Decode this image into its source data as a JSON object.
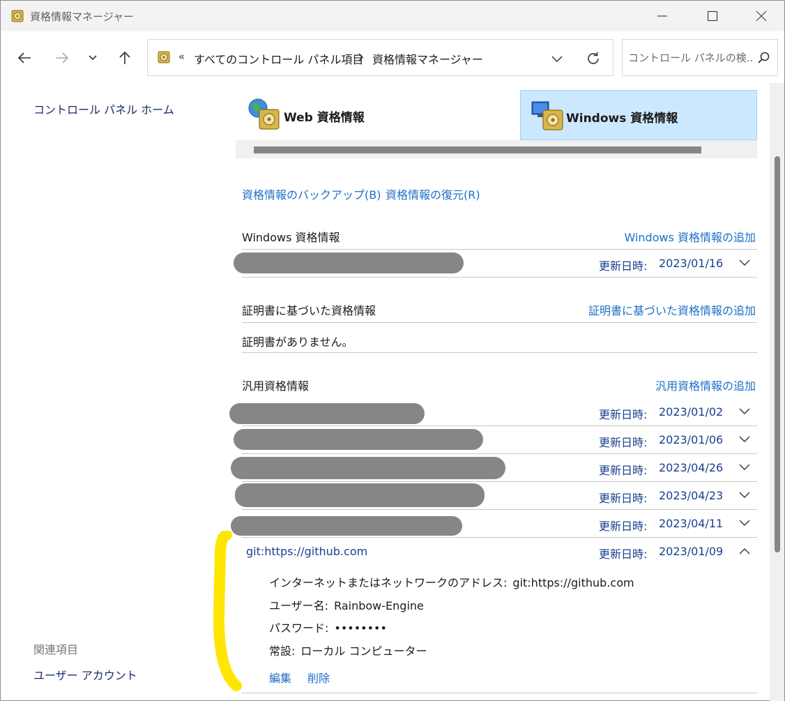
{
  "window": {
    "title": "資格情報マネージャー"
  },
  "nav": {
    "breadcrumb_chevron": "«",
    "crumb_root": "すべてのコントロール パネル項目",
    "crumb_current": "資格情報マネージャー",
    "search_placeholder": "コントロール パネルの検..."
  },
  "sidebar": {
    "home_link": "コントロール パネル ホーム",
    "related_heading": "関連項目",
    "user_accounts_link": "ユーザー アカウント"
  },
  "tabs": {
    "web": "Web 資格情報",
    "windows": "Windows 資格情報",
    "selected": "windows"
  },
  "actions": {
    "backup": "資格情報のバックアップ(B)",
    "restore": "資格情報の復元(R)"
  },
  "sections": {
    "windows": {
      "title": "Windows 資格情報",
      "add": "Windows 資格情報の追加",
      "rows": [
        {
          "date_label": "更新日時:",
          "date": "2023/01/16"
        }
      ]
    },
    "certificate": {
      "title": "証明書に基づいた資格情報",
      "add": "証明書に基づいた資格情報の追加",
      "empty": "証明書がありません。"
    },
    "generic": {
      "title": "汎用資格情報",
      "add": "汎用資格情報の追加",
      "rows": [
        {
          "date_label": "更新日時:",
          "date": "2023/01/02"
        },
        {
          "date_label": "更新日時:",
          "date": "2023/01/06"
        },
        {
          "date_label": "更新日時:",
          "date": "2023/04/26"
        },
        {
          "date_label": "更新日時:",
          "date": "2023/04/23"
        },
        {
          "date_label": "更新日時:",
          "date": "2023/04/11"
        }
      ],
      "expanded": {
        "name": "git:https://github.com",
        "date_label": "更新日時:",
        "date": "2023/01/09",
        "address_label": "インターネットまたはネットワークのアドレス:",
        "address_value": "git:https://github.com",
        "user_label": "ユーザー名:",
        "user_value": "Rainbow-Engine",
        "password_label": "パスワード:",
        "password_value": "••••••••",
        "persistence_label": "常設:",
        "persistence_value": "ローカル コンピューター",
        "edit": "編集",
        "delete": "削除"
      }
    }
  },
  "colors": {
    "link": "#1c6fc6",
    "tab_selected": "#cce8ff",
    "redaction": "#868686",
    "highlight": "#ffe600"
  }
}
